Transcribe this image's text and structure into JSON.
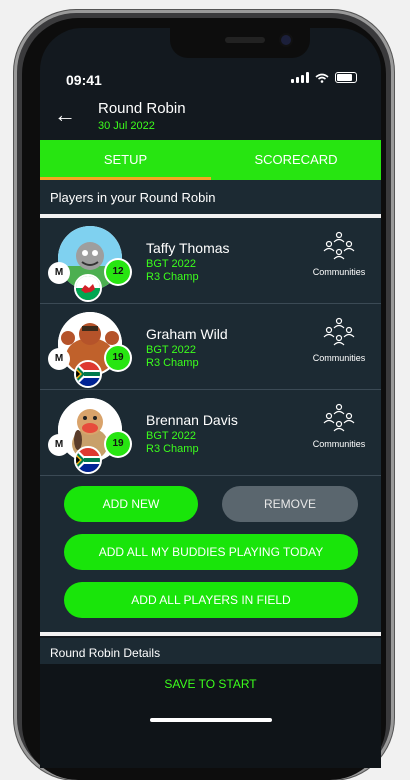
{
  "status": {
    "time": "09:41"
  },
  "header": {
    "title": "Round Robin",
    "date": "30 Jul 2022"
  },
  "tabs": [
    {
      "label": "SETUP"
    },
    {
      "label": "SCORECARD"
    }
  ],
  "players_section": {
    "title": "Players in your Round Robin"
  },
  "players": [
    {
      "name": "Taffy Thomas",
      "event": "BGT 2022",
      "status": "R3 Champ",
      "badge": "M",
      "handicap": "12",
      "communities_label": "Communities",
      "flag": "wales"
    },
    {
      "name": "Graham Wild",
      "event": "BGT 2022",
      "status": "R3 Champ",
      "badge": "M",
      "handicap": "19",
      "communities_label": "Communities",
      "flag": "south-africa"
    },
    {
      "name": "Brennan Davis",
      "event": "BGT 2022",
      "status": "R3 Champ",
      "badge": "M",
      "handicap": "19",
      "communities_label": "Communities",
      "flag": "south-africa"
    }
  ],
  "actions": {
    "add_new": "ADD NEW",
    "remove": "REMOVE",
    "add_buddies": "ADD ALL MY BUDDIES PLAYING TODAY",
    "add_field": "ADD ALL PLAYERS IN FIELD"
  },
  "details_section": {
    "title": "Round Robin Details"
  },
  "footer": {
    "save_label": "SAVE TO START"
  },
  "colors": {
    "accent_green": "#27e511",
    "tab_underline": "#f5a623",
    "panel": "#1c2a33"
  }
}
